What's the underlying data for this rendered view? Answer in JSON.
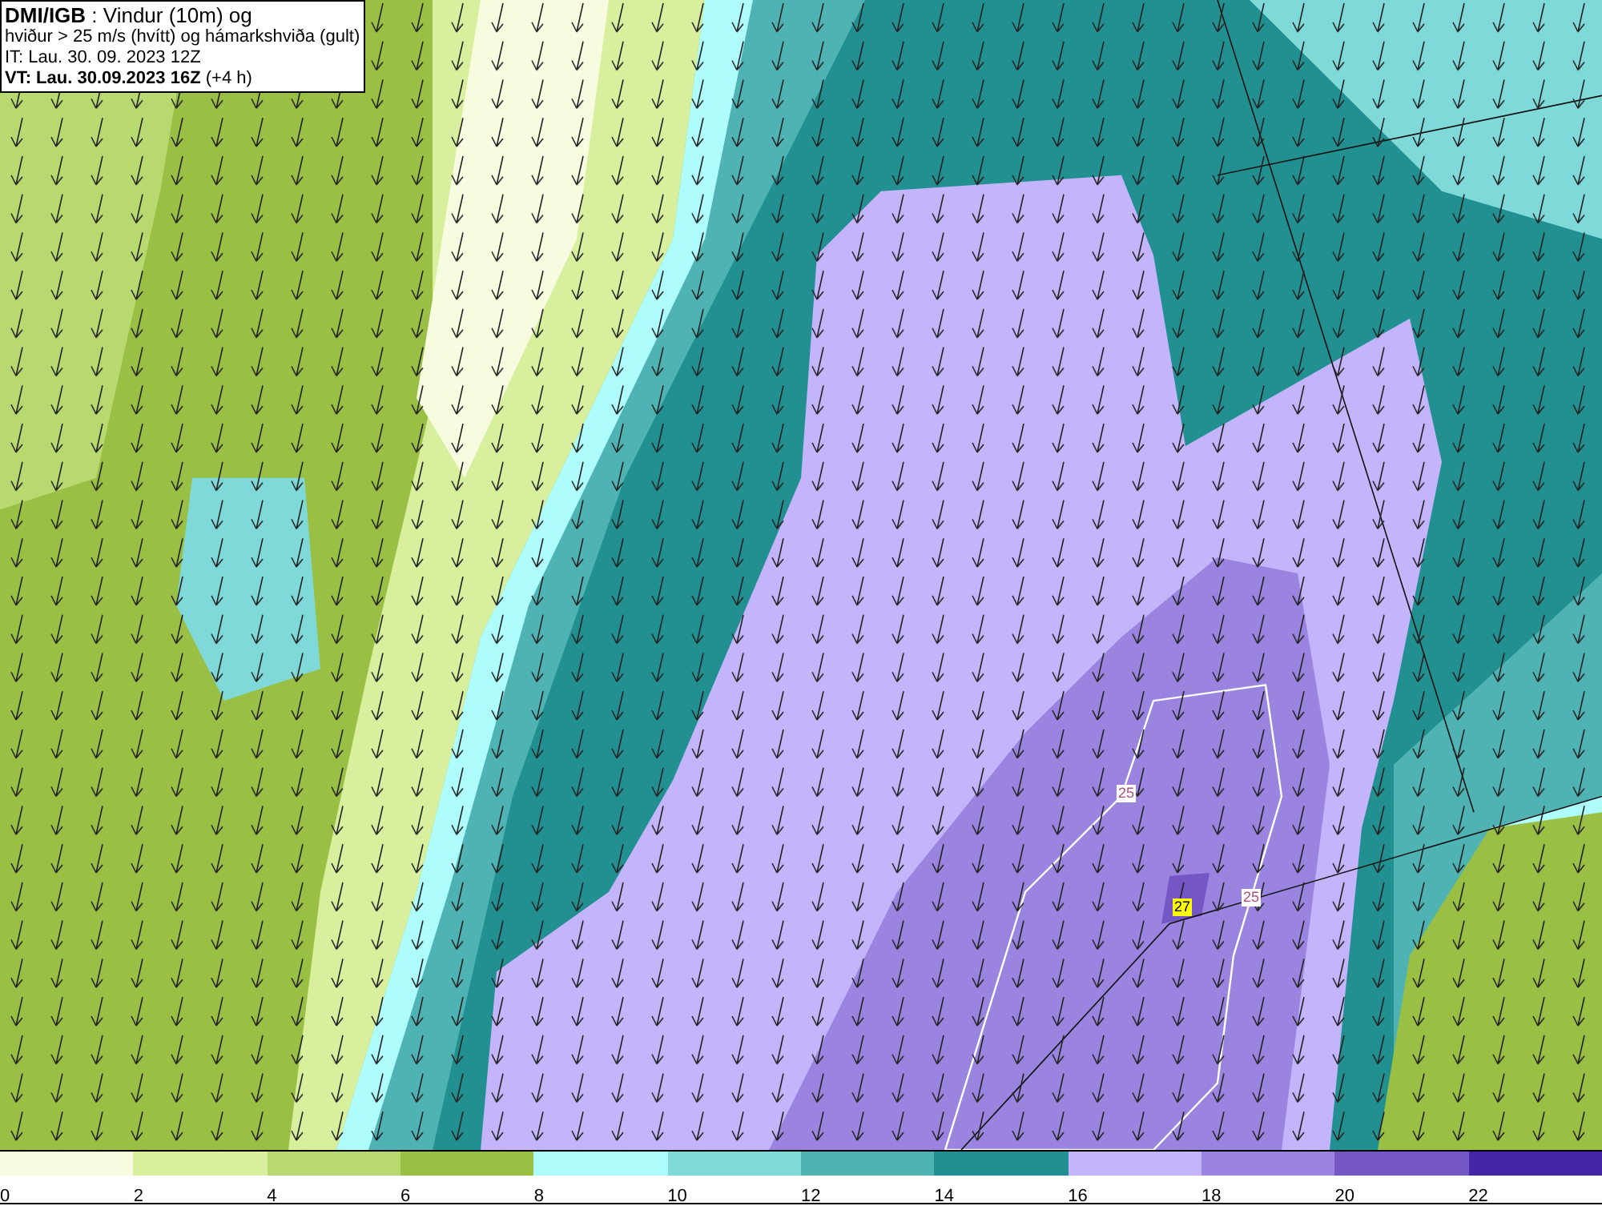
{
  "header": {
    "lines": [
      "**DMI/IGB** : Vindur (10m) og",
      "hviður > 25 m/s (hvítt) og hámarkshviða (gult)",
      "IT: Lau. 30. 09. 2023 12Z",
      "**VT: Lau. 30.09.2023 16Z** (+4 h)"
    ]
  },
  "contour_labels": [
    {
      "text": "25",
      "kind": "gust"
    },
    {
      "text": "25",
      "kind": "gust"
    },
    {
      "text": "27",
      "kind": "max"
    }
  ],
  "legend": [
    {
      "label": "0",
      "color": "#f7fce0"
    },
    {
      "label": "2",
      "color": "#d8ef9e"
    },
    {
      "label": "4",
      "color": "#b8d970"
    },
    {
      "label": "6",
      "color": "#99bf44"
    },
    {
      "label": "8",
      "color": "#aefcfc"
    },
    {
      "label": "10",
      "color": "#80d9d9"
    },
    {
      "label": "12",
      "color": "#4fb3b3"
    },
    {
      "label": "14",
      "color": "#229090"
    },
    {
      "label": "16",
      "color": "#c4b4fb"
    },
    {
      "label": "18",
      "color": "#9a84e0"
    },
    {
      "label": "20",
      "color": "#7456c4"
    },
    {
      "label": "22",
      "color": "#4326a8"
    }
  ]
}
